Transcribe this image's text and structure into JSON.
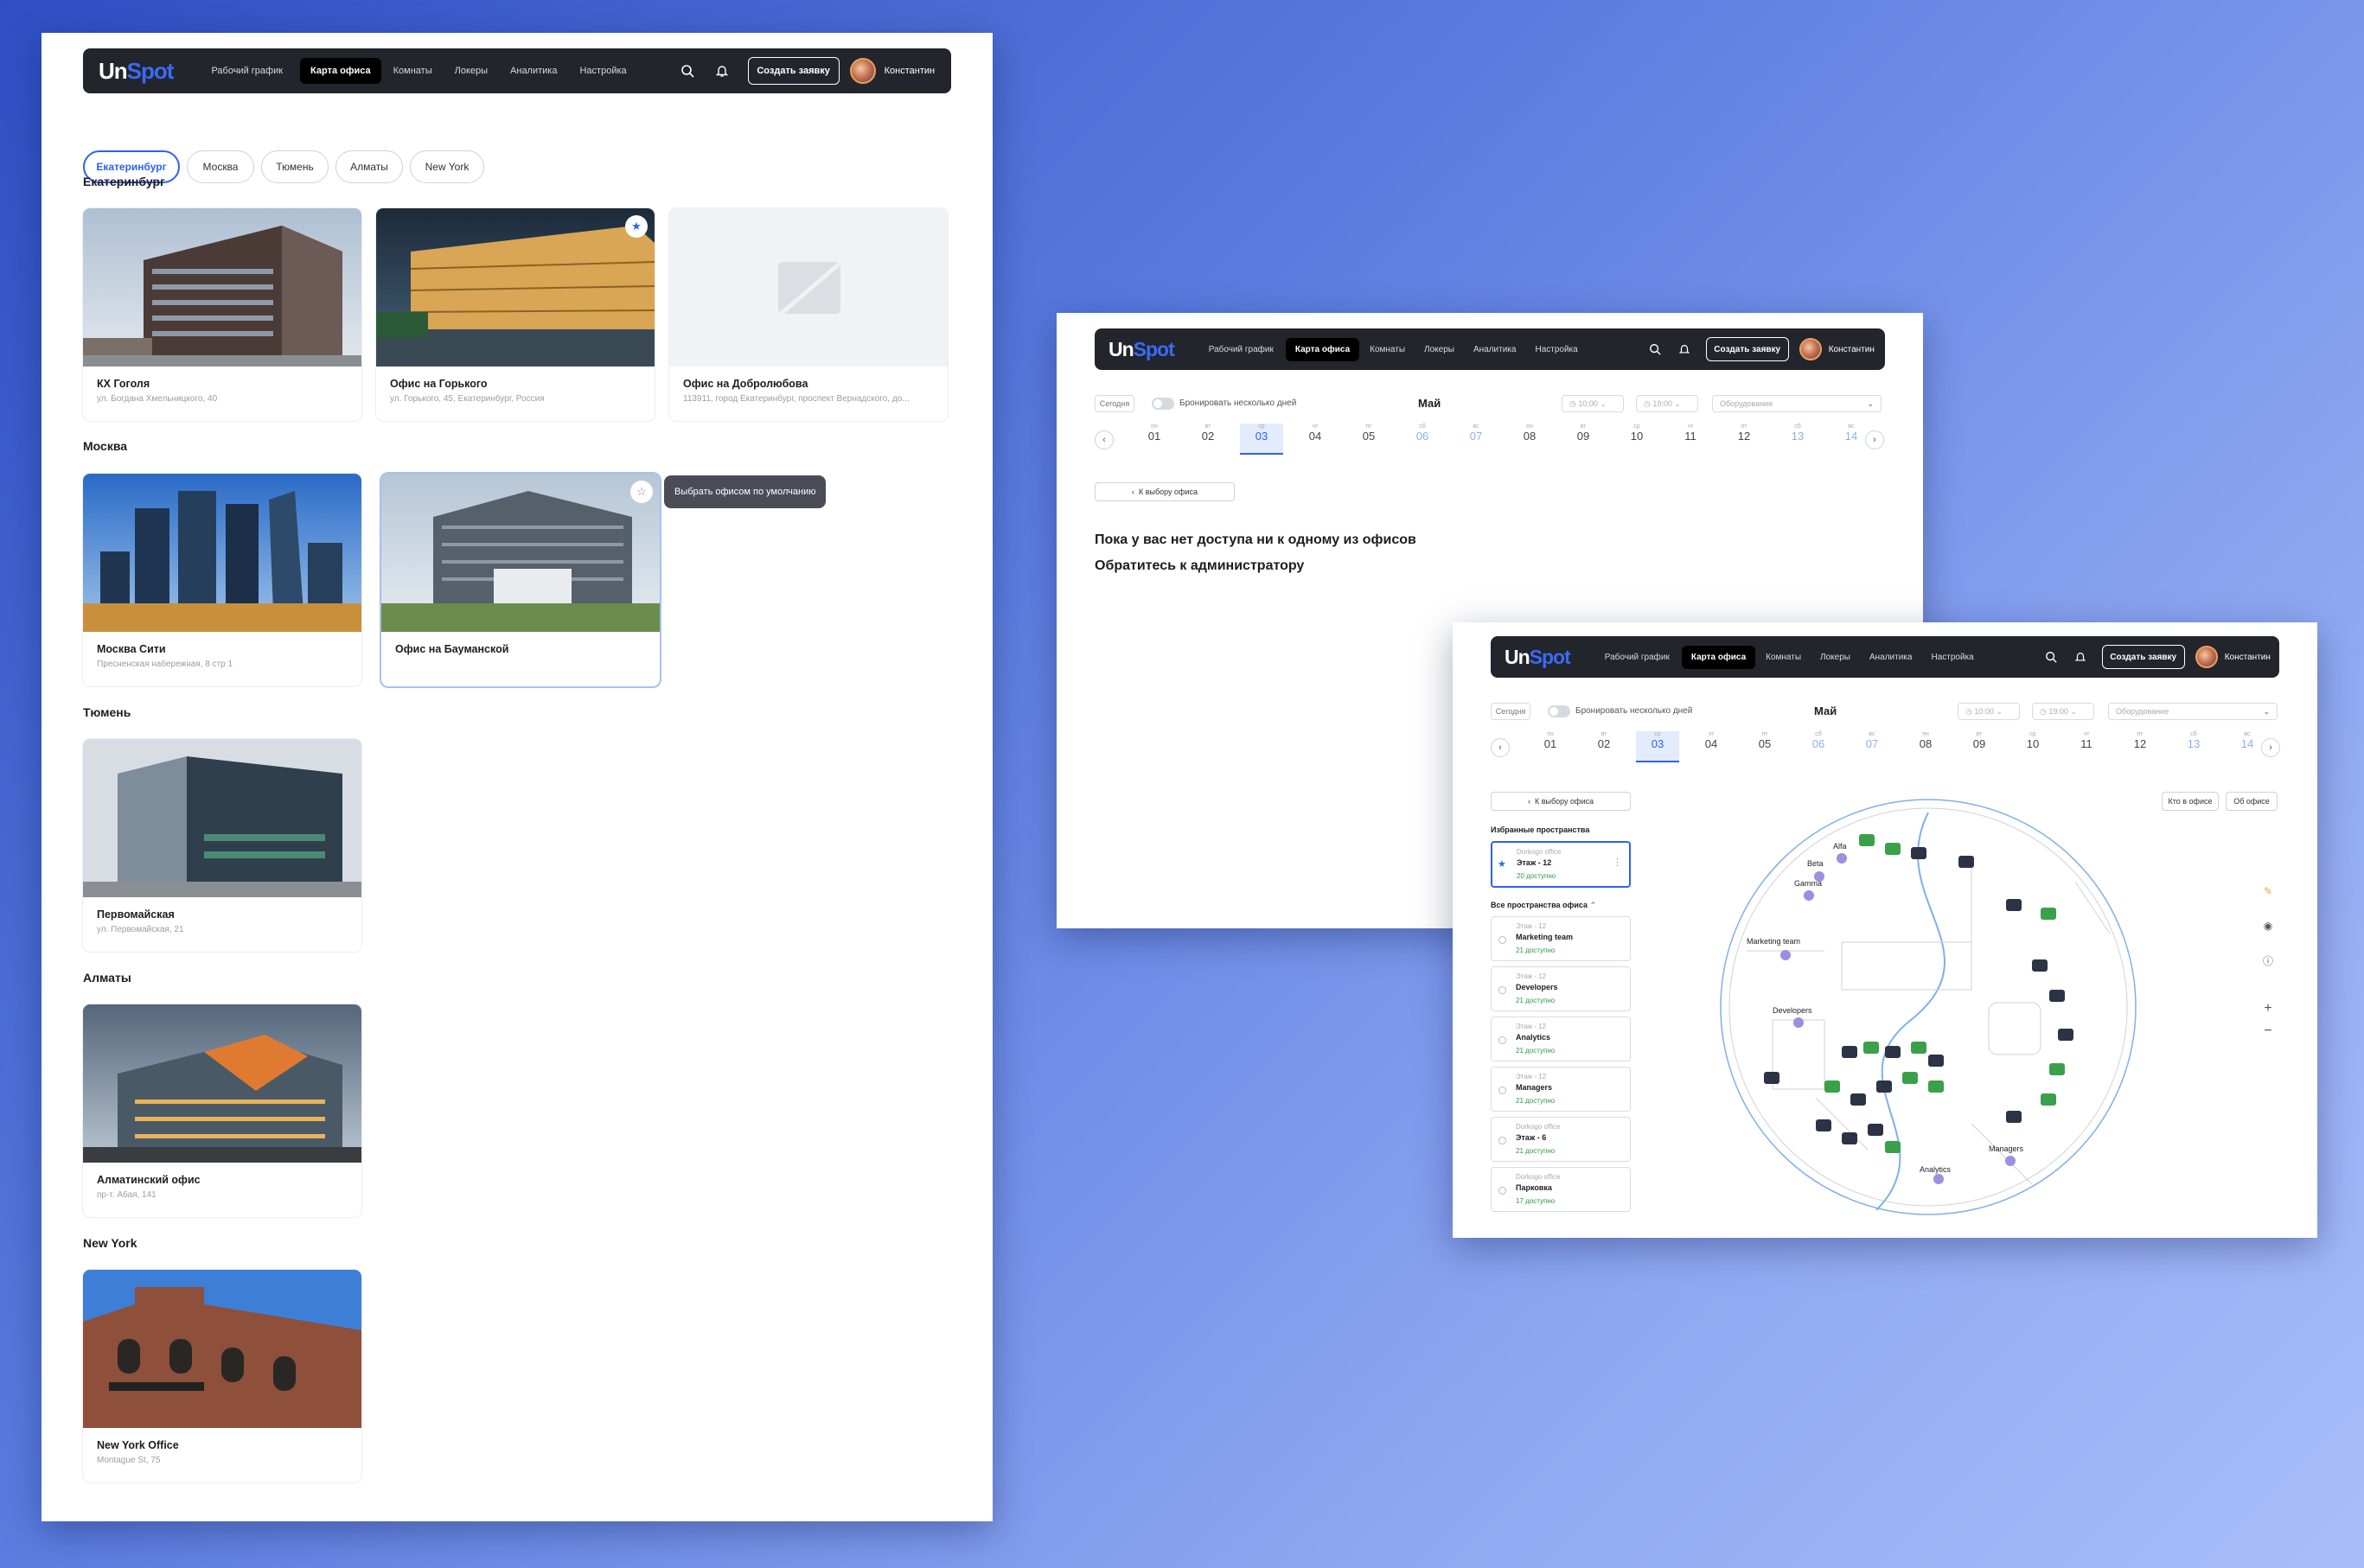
{
  "nav": {
    "logo_un": "Un",
    "logo_spot": "Spot",
    "items": [
      "Рабочий график",
      "Карта офиса",
      "Комнаты",
      "Локеры",
      "Аналитика",
      "Настройка"
    ],
    "create_button": "Создать заявку",
    "user_name": "Константин"
  },
  "filters": [
    "Екатеринбург",
    "Москва",
    "Тюмень",
    "Алматы",
    "New York"
  ],
  "groups": [
    {
      "city": "Екатеринбург",
      "offices": [
        {
          "title": "КХ Гоголя",
          "address": "ул. Богдана Хмельницкого, 40"
        },
        {
          "title": "Офис на Горького",
          "address": "ул. Горького, 45, Екатеринбург, Россия"
        },
        {
          "title": "Офис на Добролюбова",
          "address": "113911, город Екатеринбург, проспект Вернадского, до..."
        }
      ]
    },
    {
      "city": "Москва",
      "offices": [
        {
          "title": "Москва Сити",
          "address": "Пресненская набережная, 8 стр 1"
        },
        {
          "title": "Офис на Бауманской",
          "address": ""
        }
      ]
    },
    {
      "city": "Тюмень",
      "offices": [
        {
          "title": "Первомайская",
          "address": "ул. Первомайская, 21"
        }
      ]
    },
    {
      "city": "Алматы",
      "offices": [
        {
          "title": "Алматинский офис",
          "address": "пр-т. Абая, 141"
        }
      ]
    },
    {
      "city": "New York",
      "offices": [
        {
          "title": "New York Office",
          "address": "Montague St, 75"
        }
      ]
    }
  ],
  "tooltip": "Выбрать офисом по умолчанию",
  "toolbar": {
    "today": "Сегодня",
    "multi_days": "Бронировать несколько дней",
    "month": "Май",
    "time_from": "10:00",
    "time_to": "19:00",
    "equipment": "Оборудование"
  },
  "days": [
    {
      "w": "пн",
      "n": "01"
    },
    {
      "w": "вт",
      "n": "02"
    },
    {
      "w": "ср",
      "n": "03"
    },
    {
      "w": "чт",
      "n": "04"
    },
    {
      "w": "пт",
      "n": "05"
    },
    {
      "w": "сб",
      "n": "06"
    },
    {
      "w": "вс",
      "n": "07"
    },
    {
      "w": "пн",
      "n": "08"
    },
    {
      "w": "вт",
      "n": "09"
    },
    {
      "w": "ср",
      "n": "10"
    },
    {
      "w": "чт",
      "n": "11"
    },
    {
      "w": "пт",
      "n": "12"
    },
    {
      "w": "сб",
      "n": "13"
    },
    {
      "w": "вс",
      "n": "14"
    }
  ],
  "back_button": "К выбору офиса",
  "no_access": {
    "line1": "Пока у вас нет доступа ни к одному из офисов",
    "line2": "Обратитесь к администратору"
  },
  "map_view": {
    "favorites_title": "Избранные пространства",
    "all_title": "Все пространства офиса",
    "who_button": "Кто в офисе",
    "about_button": "Об офисе",
    "favorite": {
      "office": "Dorkogo office",
      "floor": "Этаж - 12",
      "available": "20 доступно"
    },
    "spaces": [
      {
        "office": "Этаж - 12",
        "name": "Marketing team",
        "available": "21 доступно"
      },
      {
        "office": "Этаж - 12",
        "name": "Developers",
        "available": "21 доступно"
      },
      {
        "office": "Этаж - 12",
        "name": "Analytics",
        "available": "21 доступно"
      },
      {
        "office": "Этаж - 12",
        "name": "Managers",
        "available": "21 доступно"
      },
      {
        "office": "Dorkogo office",
        "name": "Этаж - 6",
        "available": "21 доступно"
      },
      {
        "office": "Dorkogo office",
        "name": "Парковка",
        "available": "17 доступно"
      }
    ],
    "zones": [
      "Alfa",
      "Beta",
      "Gamma",
      "Marketing team",
      "Developers",
      "Managers",
      "Analytics"
    ]
  },
  "colors": {
    "accent": "#2d62f0",
    "nav_bg": "#23252c",
    "available": "#2a9b3c"
  }
}
